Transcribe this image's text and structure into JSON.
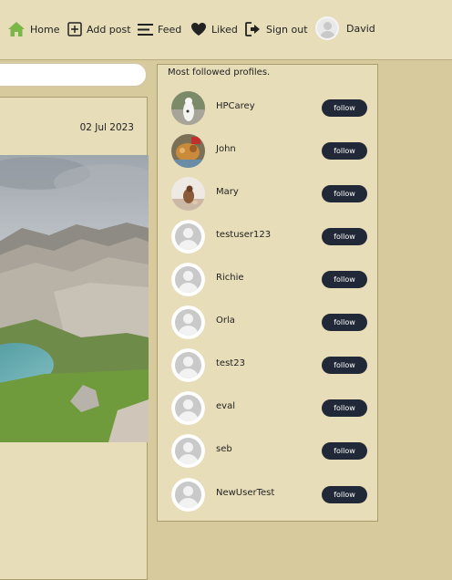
{
  "nav": {
    "home_label": "Home",
    "add_post_label": "Add post",
    "feed_label": "Feed",
    "liked_label": "Liked",
    "sign_out_label": "Sign out",
    "user_name": "David"
  },
  "post": {
    "date": "02 Jul 2023"
  },
  "profiles": {
    "title": "Most followed profiles.",
    "follow_label": "follow",
    "items": [
      {
        "name": "HPCarey",
        "avatar": "photo"
      },
      {
        "name": "John",
        "avatar": "photo"
      },
      {
        "name": "Mary",
        "avatar": "photo"
      },
      {
        "name": "testuser123",
        "avatar": "default"
      },
      {
        "name": "Richie",
        "avatar": "default"
      },
      {
        "name": "Orla",
        "avatar": "default"
      },
      {
        "name": "test23",
        "avatar": "default"
      },
      {
        "name": "eval",
        "avatar": "default"
      },
      {
        "name": "seb",
        "avatar": "default"
      },
      {
        "name": "NewUserTest",
        "avatar": "default"
      }
    ]
  },
  "colors": {
    "background": "#d7cb9e",
    "panel": "#e7ddb9",
    "button": "#212837",
    "home_icon": "#7ab648"
  }
}
